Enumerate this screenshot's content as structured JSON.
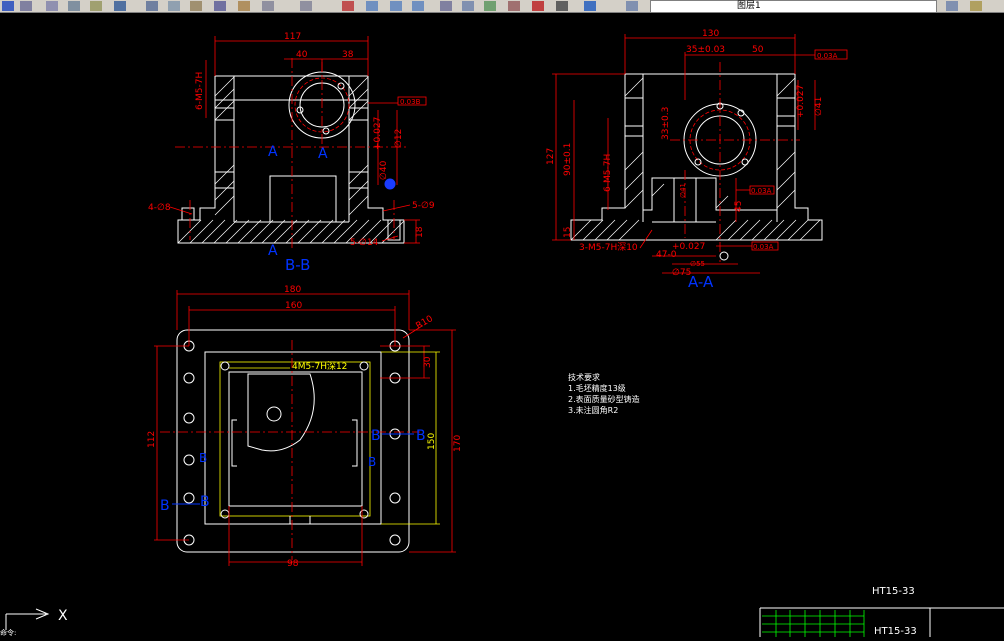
{
  "toolbar": {
    "layer_name": "图层1"
  },
  "views": {
    "bb_label": "B-B",
    "aa_label": "A-A",
    "section_a": "A",
    "section_b": "B"
  },
  "dims_bb": {
    "d117": "117",
    "d40": "40",
    "d38": "38",
    "thread": "6-M5-7H",
    "tol1": "0.03B",
    "d40b": "∅40",
    "d027": "+0.027",
    "d12": "∅12",
    "holes8": "4-∅8",
    "holes9": "5-∅9",
    "holes14": "5-∅14",
    "d18": "18"
  },
  "dims_aa": {
    "d130": "130",
    "d35": "35±0.03",
    "d50": "50",
    "tol2": "0.03A",
    "d127": "127",
    "d90": "90±0.1",
    "d33": "33±0.3",
    "thread": "6-M5-7H",
    "d027": "+0.027",
    "d41": "∅41",
    "d45": "45",
    "d15": "15",
    "thread3": "3-M5-7H深10",
    "d47": "47-0",
    "d55": "∅55",
    "d75": "∅75",
    "tol3": "0.03A",
    "tol4": "0.03A"
  },
  "dims_plan": {
    "d180": "180",
    "d160": "160",
    "r10": "R10",
    "thread": "4M5-7H深12",
    "d30": "30",
    "d112": "112",
    "d150": "150",
    "d170": "170",
    "d98": "98"
  },
  "tech_notes": {
    "title": "技术要求",
    "lines": [
      "1.毛坯精度13级",
      "2.表面质量砂型铸造",
      "3.未注圆角R2"
    ]
  },
  "title_block": {
    "code1": "HT15-33",
    "code2": "HT15-33"
  },
  "ucs": {
    "x_label": "X"
  },
  "command_line": "命令:"
}
